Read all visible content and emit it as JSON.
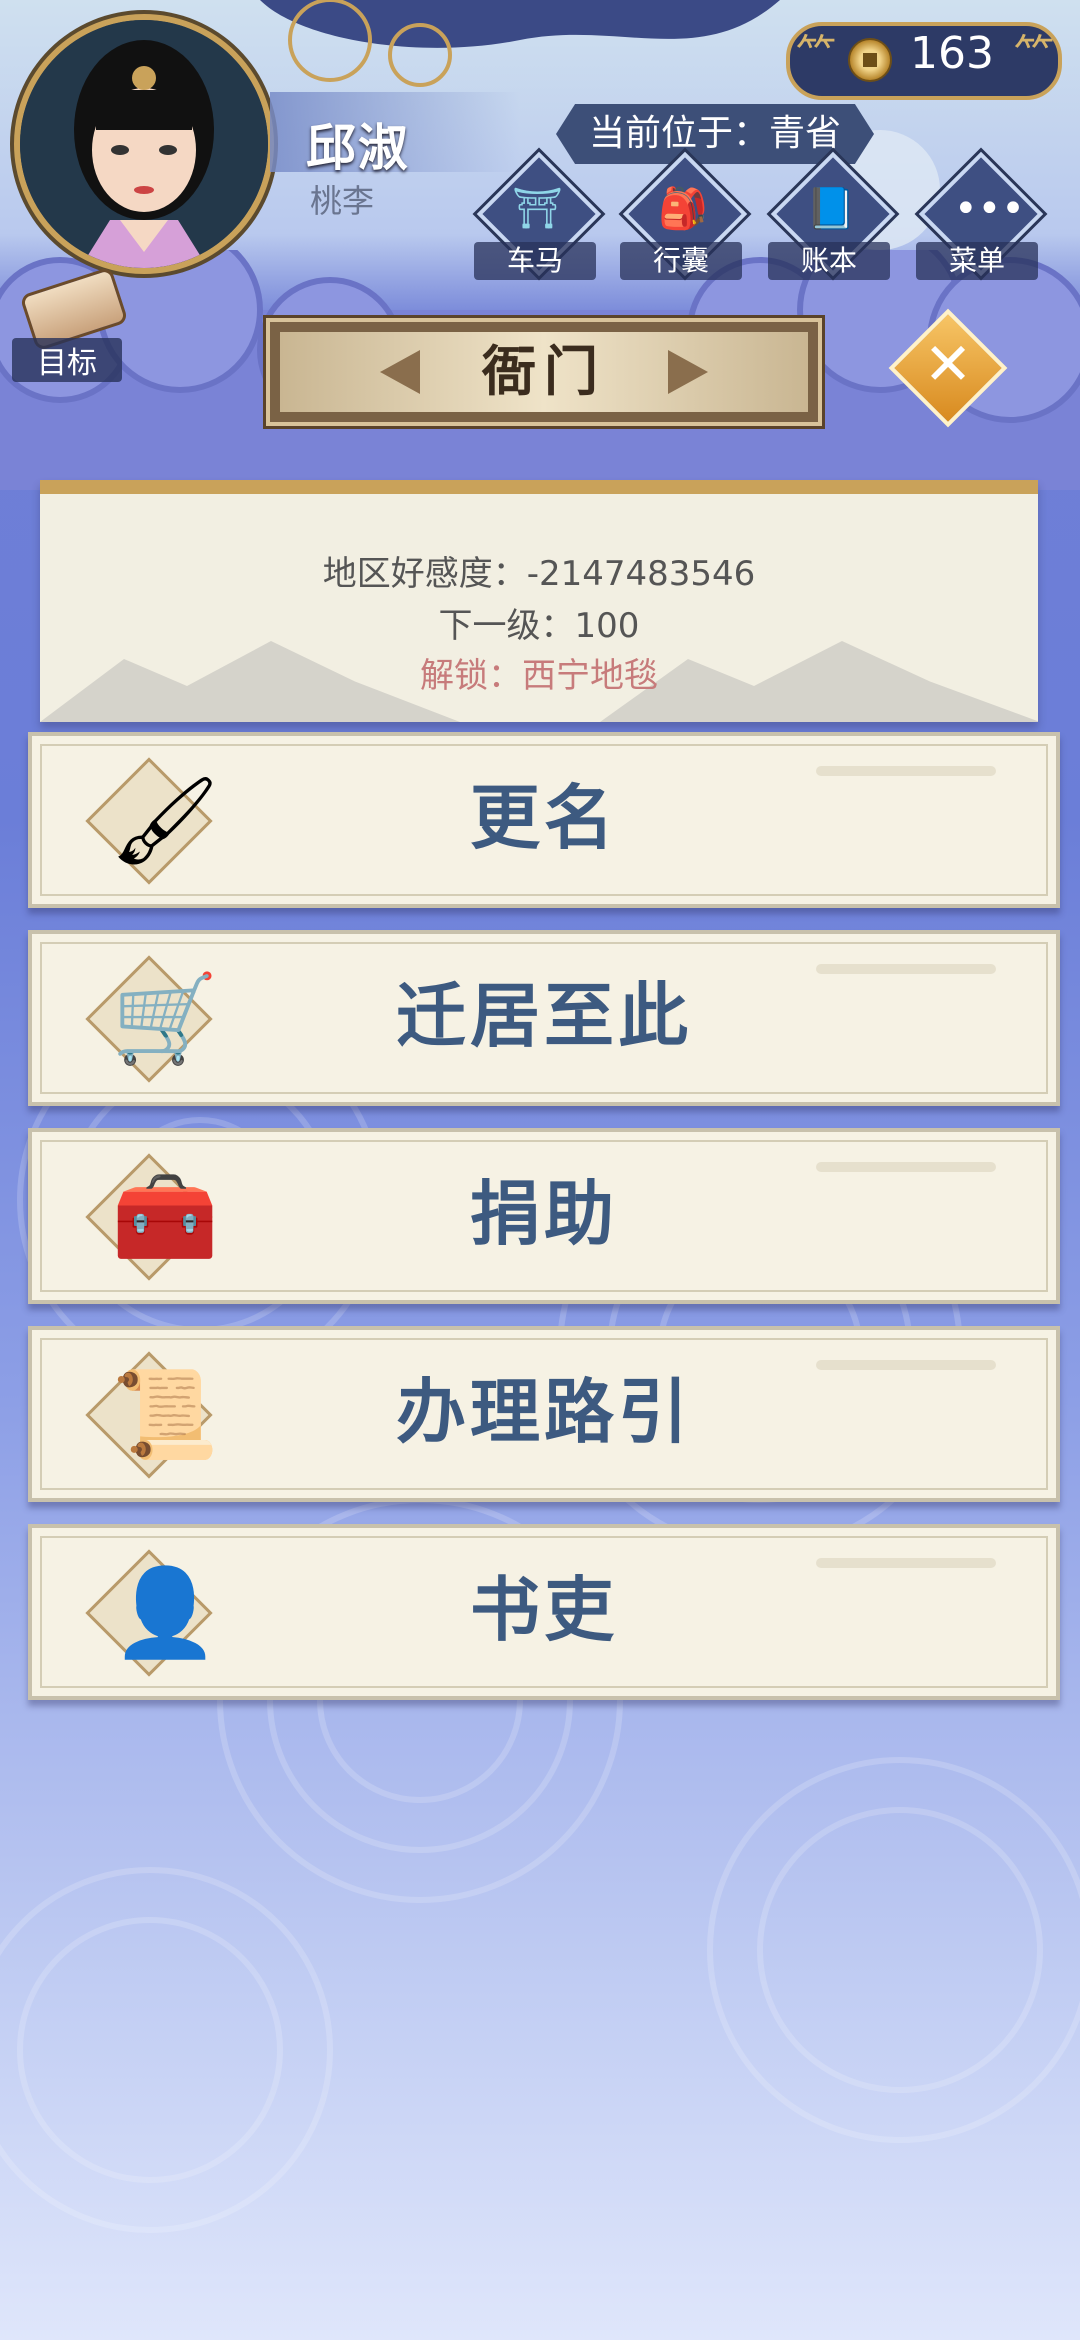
{
  "player": {
    "name": "邱淑",
    "subtitle": "桃李"
  },
  "currency": {
    "icon": "coin-icon",
    "value": "163"
  },
  "location": {
    "text": "当前位于：青省"
  },
  "nav": [
    {
      "label": "车马",
      "icon": "carriage-icon"
    },
    {
      "label": "行囊",
      "icon": "bundle-icon"
    },
    {
      "label": "账本",
      "icon": "ledger-icon"
    },
    {
      "label": "菜单",
      "icon": "more-icon"
    }
  ],
  "goal": {
    "label": "目标",
    "icon": "scroll-icon"
  },
  "title": "衙门",
  "close": {
    "icon": "close-icon"
  },
  "info": {
    "favor": "地区好感度：-2147483546",
    "next": "下一级：100",
    "unlock": "解锁：西宁地毯"
  },
  "menu": [
    {
      "label": "更名",
      "icon": "brush-icon",
      "glyph": "🖌"
    },
    {
      "label": "迁居至此",
      "icon": "cart-icon",
      "glyph": "🛒"
    },
    {
      "label": "捐助",
      "icon": "chest-icon",
      "glyph": "🧰"
    },
    {
      "label": "办理路引",
      "icon": "documents-icon",
      "glyph": "📜"
    },
    {
      "label": "书吏",
      "icon": "clerk-icon",
      "glyph": "👤"
    }
  ],
  "colors": {
    "accent_gold": "#c9a25a",
    "menu_text": "#3d5a80",
    "unlock_text": "#c77b7b",
    "close_orange": "#d88a1f"
  }
}
